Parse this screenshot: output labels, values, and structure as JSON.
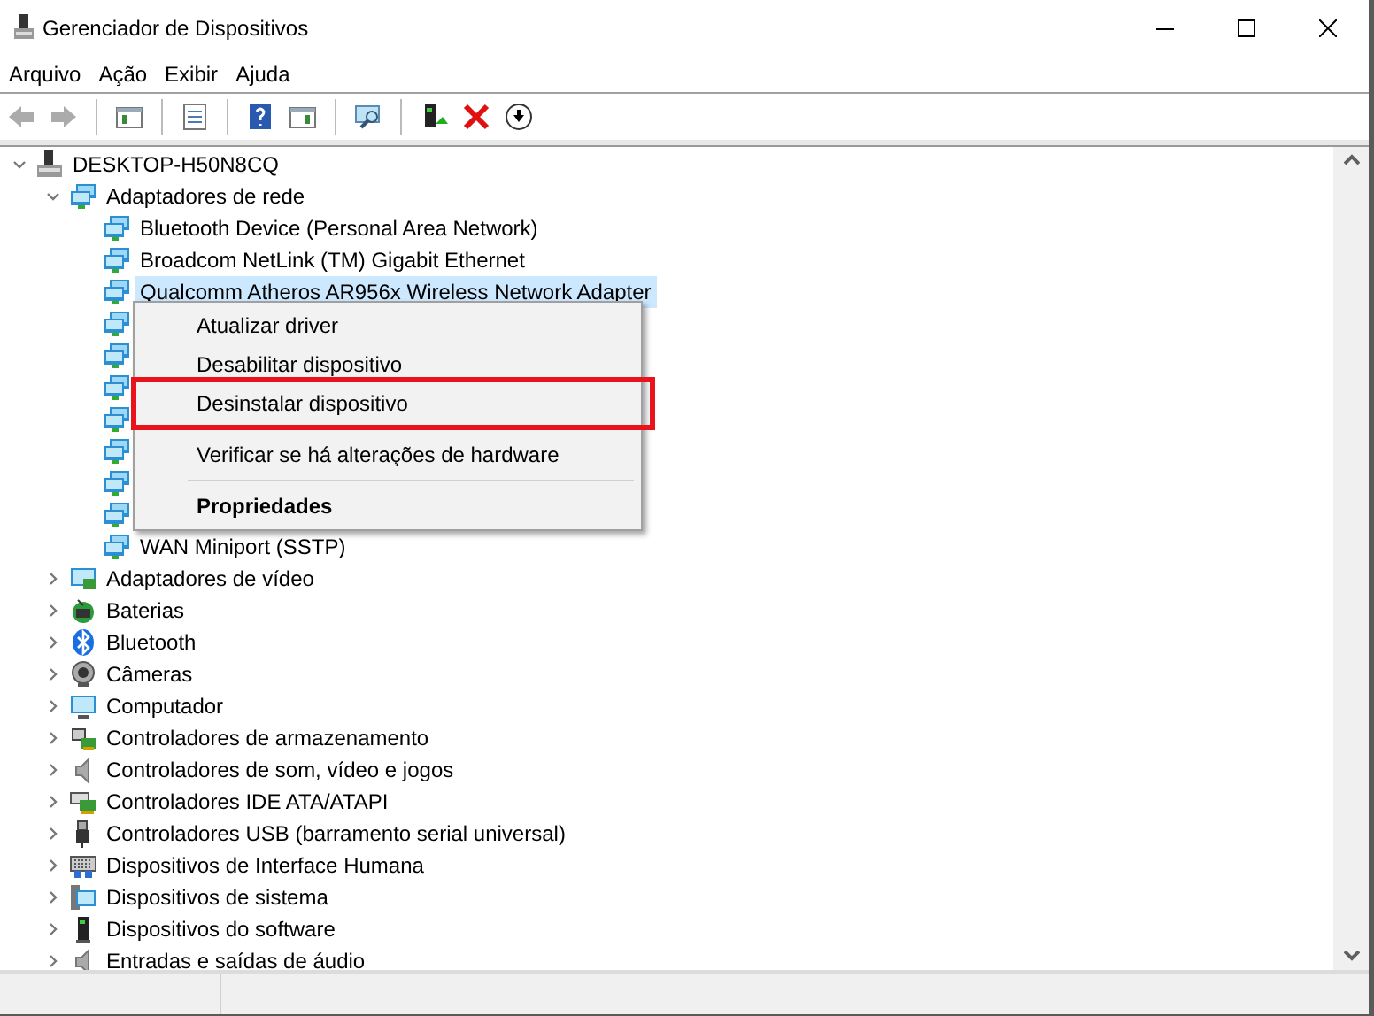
{
  "window": {
    "title": "Gerenciador de Dispositivos"
  },
  "menu_bar": [
    "Arquivo",
    "Ação",
    "Exibir",
    "Ajuda"
  ],
  "toolbar": [
    {
      "kind": "back",
      "disabled": true
    },
    {
      "kind": "forward",
      "disabled": true
    },
    {
      "kind": "separator"
    },
    {
      "kind": "console",
      "disabled": false
    },
    {
      "kind": "separator"
    },
    {
      "kind": "properties",
      "disabled": false
    },
    {
      "kind": "separator"
    },
    {
      "kind": "help",
      "disabled": false
    },
    {
      "kind": "action-pane",
      "disabled": false
    },
    {
      "kind": "separator"
    },
    {
      "kind": "scan",
      "disabled": false
    },
    {
      "kind": "separator"
    },
    {
      "kind": "update",
      "disabled": false
    },
    {
      "kind": "uninstall",
      "disabled": false
    },
    {
      "kind": "download",
      "disabled": false
    }
  ],
  "tree": {
    "label": "DESKTOP-H50N8CQ",
    "kind": "computer",
    "expanded": true,
    "children": [
      {
        "label": "Adaptadores de rede",
        "kind": "network",
        "expanded": true,
        "children": [
          {
            "label": "Bluetooth Device (Personal Area Network)",
            "kind": "network",
            "selected": false
          },
          {
            "label": "Broadcom NetLink (TM) Gigabit Ethernet",
            "kind": "network",
            "selected": false
          },
          {
            "label": "Qualcomm Atheros AR956x Wireless Network Adapter",
            "kind": "network",
            "selected": true
          },
          {
            "kind": "network"
          },
          {
            "kind": "network"
          },
          {
            "kind": "network"
          },
          {
            "kind": "network"
          },
          {
            "kind": "network"
          },
          {
            "kind": "network"
          },
          {
            "kind": "network"
          },
          {
            "label": "WAN Miniport (SSTP)",
            "kind": "network",
            "selected": false
          }
        ]
      },
      {
        "label": "Adaptadores de vídeo",
        "kind": "display",
        "expanded": false
      },
      {
        "label": "Baterias",
        "kind": "battery",
        "expanded": false
      },
      {
        "label": "Bluetooth",
        "kind": "bluetooth",
        "expanded": false
      },
      {
        "label": "Câmeras",
        "kind": "camera",
        "expanded": false
      },
      {
        "label": "Computador",
        "kind": "monitor",
        "expanded": false
      },
      {
        "label": "Controladores de armazenamento",
        "kind": "storage",
        "expanded": false
      },
      {
        "label": "Controladores de som, vídeo e jogos",
        "kind": "sound",
        "expanded": false
      },
      {
        "label": "Controladores IDE ATA/ATAPI",
        "kind": "ide",
        "expanded": false
      },
      {
        "label": "Controladores USB (barramento serial universal)",
        "kind": "usb",
        "expanded": false
      },
      {
        "label": "Dispositivos de Interface Humana",
        "kind": "hid",
        "expanded": false
      },
      {
        "label": "Dispositivos de sistema",
        "kind": "system",
        "expanded": false
      },
      {
        "label": "Dispositivos do software",
        "kind": "software",
        "expanded": false
      },
      {
        "label": "Entradas e saídas de áudio",
        "kind": "sound",
        "expanded": false
      }
    ]
  },
  "context_menu": [
    {
      "kind": "item",
      "label": "Atualizar driver",
      "highlighted": false
    },
    {
      "kind": "item",
      "label": "Desabilitar dispositivo",
      "highlighted": false
    },
    {
      "kind": "item",
      "label": "Desinstalar dispositivo",
      "highlighted": true
    },
    {
      "kind": "separator"
    },
    {
      "kind": "item",
      "label": "Verificar se há alterações de hardware",
      "highlighted": false
    },
    {
      "kind": "separator"
    },
    {
      "kind": "default",
      "label": "Propriedades",
      "highlighted": false
    }
  ]
}
